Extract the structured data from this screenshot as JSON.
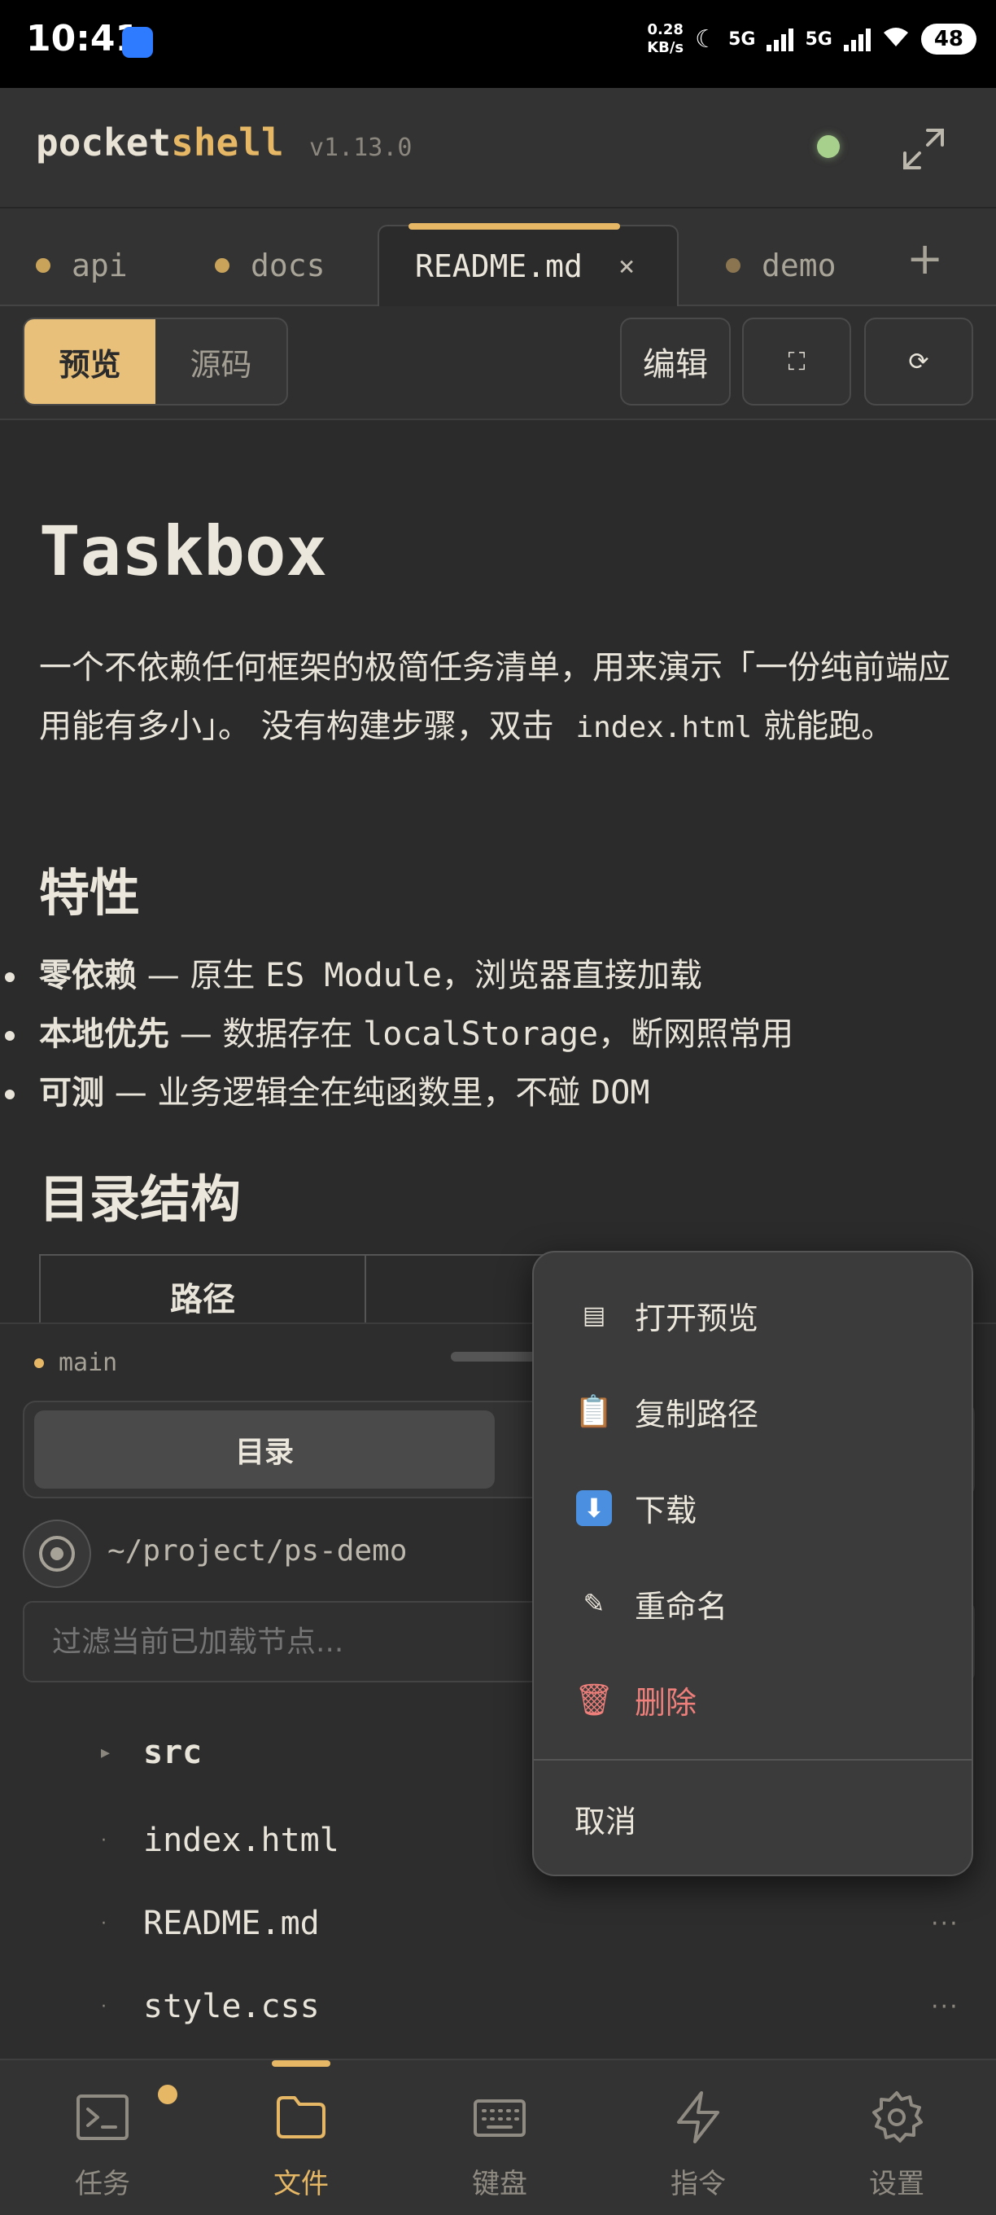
{
  "status_bar": {
    "time": "10:41",
    "net_speed": "0.28\nKB/s",
    "sim1": "5G",
    "sim2": "5G",
    "battery": "48"
  },
  "app": {
    "brand_prefix": "pocket",
    "brand_suffix": "shell",
    "version": "v1.13.0",
    "accent_color": "#e6b866",
    "online_color": "#a6d08c"
  },
  "tabs": [
    {
      "label": "api",
      "active": false
    },
    {
      "label": "docs",
      "active": false
    },
    {
      "label": "README.md",
      "active": true
    },
    {
      "label": "demo",
      "active": false
    }
  ],
  "tab_close": "×",
  "tab_add": "+",
  "toolbar": {
    "preview_label": "预览",
    "source_label": "源码",
    "edit_label": "编辑",
    "fullscreen_icon": "⛶",
    "refresh_icon": "⟳"
  },
  "doc": {
    "title": "Taskbox",
    "intro_1": "一个不依赖任何框架的极简任务清单，用来演示「一份纯前端应用能有多小」。 没有构建步骤，双击",
    "intro_code": "index.html",
    "intro_2": "就能跑。",
    "features_heading": "特性",
    "features": [
      {
        "bold": "零依赖",
        "dash": " — ",
        "text_a": "原生 ",
        "mono": "ES Module",
        "text_b": "，浏览器直接加载"
      },
      {
        "bold": "本地优先",
        "dash": " — ",
        "text_a": "数据存在 ",
        "mono": "localStorage",
        "text_b": "，断网照常用"
      },
      {
        "bold": "可测",
        "dash": " — ",
        "text_a": "业务逻辑全在纯函数里，不碰 ",
        "mono": "DOM",
        "text_b": ""
      }
    ],
    "structure_heading": "目录结构",
    "table_header_path": "路径"
  },
  "files": {
    "branch": "main",
    "segment_active": "目录",
    "cwd": "~/project/ps-demo",
    "filter_placeholder": "过滤当前已加载节点...",
    "items": [
      {
        "name": "src",
        "type": "dir",
        "marker": "▸"
      },
      {
        "name": "index.html",
        "type": "file",
        "marker": "·"
      },
      {
        "name": "README.md",
        "type": "file",
        "marker": "·"
      },
      {
        "name": "style.css",
        "type": "file",
        "marker": "·"
      }
    ],
    "more_icon": "···"
  },
  "context_menu": {
    "items": [
      {
        "icon": "▤",
        "label": "打开预览",
        "danger": false
      },
      {
        "icon": "📋",
        "label": "复制路径",
        "danger": false
      },
      {
        "icon": "⬇",
        "label": "下载",
        "danger": false
      },
      {
        "icon": "✎",
        "label": "重命名",
        "danger": false
      },
      {
        "icon": "🗑",
        "label": "删除",
        "danger": true
      }
    ],
    "cancel": "取消"
  },
  "bottom_nav": [
    {
      "icon": "terminal-icon",
      "label": "任务",
      "active": false
    },
    {
      "icon": "folder-icon",
      "label": "文件",
      "active": true
    },
    {
      "icon": "keyboard-icon",
      "label": "键盘",
      "active": false
    },
    {
      "icon": "bolt-icon",
      "label": "指令",
      "active": false
    },
    {
      "icon": "gear-icon",
      "label": "设置",
      "active": false
    }
  ]
}
